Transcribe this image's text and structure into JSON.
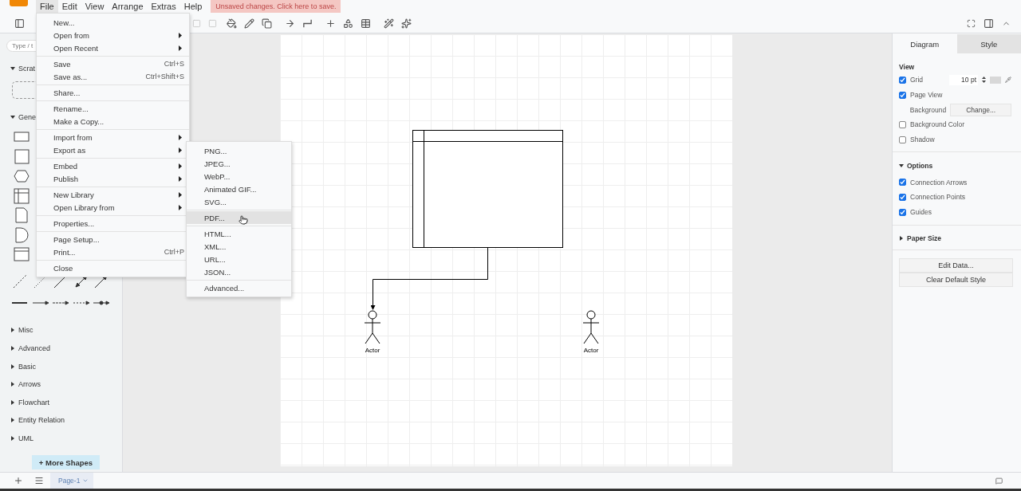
{
  "menubar": {
    "items": [
      {
        "label": "File",
        "selected": true
      },
      {
        "label": "Edit",
        "selected": false
      },
      {
        "label": "View",
        "selected": false
      },
      {
        "label": "Arrange",
        "selected": false
      },
      {
        "label": "Extras",
        "selected": false
      },
      {
        "label": "Help",
        "selected": false
      }
    ],
    "unsaved_notice": "Unsaved changes. Click here to save."
  },
  "file_menu": {
    "groups": [
      [
        {
          "label": "New...",
          "submenu": false
        },
        {
          "label": "Open from",
          "submenu": true
        },
        {
          "label": "Open Recent",
          "submenu": true
        }
      ],
      [
        {
          "label": "Save",
          "submenu": false,
          "shortcut": "Ctrl+S"
        },
        {
          "label": "Save as...",
          "submenu": false,
          "shortcut": "Ctrl+Shift+S"
        }
      ],
      [
        {
          "label": "Share...",
          "submenu": false
        }
      ],
      [
        {
          "label": "Rename...",
          "submenu": false
        },
        {
          "label": "Make a Copy...",
          "submenu": false
        }
      ],
      [
        {
          "label": "Import from",
          "submenu": true
        },
        {
          "label": "Export as",
          "submenu": true
        }
      ],
      [
        {
          "label": "Embed",
          "submenu": true
        },
        {
          "label": "Publish",
          "submenu": true
        }
      ],
      [
        {
          "label": "New Library",
          "submenu": true
        },
        {
          "label": "Open Library from",
          "submenu": true
        }
      ],
      [
        {
          "label": "Properties...",
          "submenu": false
        }
      ],
      [
        {
          "label": "Page Setup...",
          "submenu": false
        },
        {
          "label": "Print...",
          "submenu": false,
          "shortcut": "Ctrl+P"
        }
      ],
      [
        {
          "label": "Close",
          "submenu": false
        }
      ]
    ]
  },
  "export_submenu": {
    "groups": [
      [
        {
          "label": "PNG...",
          "selected": false
        },
        {
          "label": "JPEG...",
          "selected": false
        },
        {
          "label": "WebP...",
          "selected": false
        },
        {
          "label": "Animated GIF...",
          "selected": false
        },
        {
          "label": "SVG...",
          "selected": false
        }
      ],
      [
        {
          "label": "PDF...",
          "selected": true
        }
      ],
      [
        {
          "label": "HTML...",
          "selected": false
        },
        {
          "label": "XML...",
          "selected": false
        },
        {
          "label": "URL...",
          "selected": false
        },
        {
          "label": "JSON...",
          "selected": false
        }
      ],
      [
        {
          "label": "Advanced...",
          "selected": false
        }
      ]
    ]
  },
  "sidebar": {
    "search": {
      "placeholder": "Type / t"
    },
    "sections": [
      {
        "label": "Scrat",
        "expanded": true,
        "kind": "scratchpad"
      },
      {
        "label": "Gene",
        "expanded": true,
        "kind": "shapes"
      },
      {
        "label": "Misc",
        "expanded": false
      },
      {
        "label": "Advanced",
        "expanded": false
      },
      {
        "label": "Basic",
        "expanded": false
      },
      {
        "label": "Arrows",
        "expanded": false
      },
      {
        "label": "Flowchart",
        "expanded": false
      },
      {
        "label": "Entity Relation",
        "expanded": false
      },
      {
        "label": "UML",
        "expanded": false
      }
    ],
    "more_shapes": "+ More Shapes"
  },
  "canvas": {
    "shapes": [
      {
        "kind": "table"
      },
      {
        "kind": "actor",
        "label": "Actor"
      },
      {
        "kind": "actor",
        "label": "Actor"
      }
    ]
  },
  "format_panel": {
    "tabs": [
      {
        "label": "Diagram",
        "selected": true
      },
      {
        "label": "Style",
        "selected": false
      }
    ],
    "sections": [
      {
        "title": "View",
        "kind": "plain",
        "rows": [
          {
            "kind": "checkbox",
            "label": "Grid",
            "checked": true,
            "value": "10 pt"
          },
          {
            "kind": "checkbox",
            "label": "Page View",
            "checked": true
          },
          {
            "kind": "button-row",
            "label": "Background",
            "button": "Change..."
          },
          {
            "kind": "checkbox",
            "label": "Background Color",
            "checked": false
          },
          {
            "kind": "checkbox",
            "label": "Shadow",
            "checked": false
          }
        ]
      },
      {
        "title": "Options",
        "kind": "collapsible",
        "expanded": true,
        "rows": [
          {
            "kind": "checkbox",
            "label": "Connection Arrows",
            "checked": true
          },
          {
            "kind": "checkbox",
            "label": "Connection Points",
            "checked": true
          },
          {
            "kind": "checkbox",
            "label": "Guides",
            "checked": true
          }
        ]
      },
      {
        "title": "Paper Size",
        "kind": "collapsible",
        "expanded": false
      }
    ],
    "buttons": [
      "Edit Data...",
      "Clear Default Style"
    ]
  },
  "page_tabs": [
    {
      "label": "Page-1",
      "selected": true
    }
  ]
}
